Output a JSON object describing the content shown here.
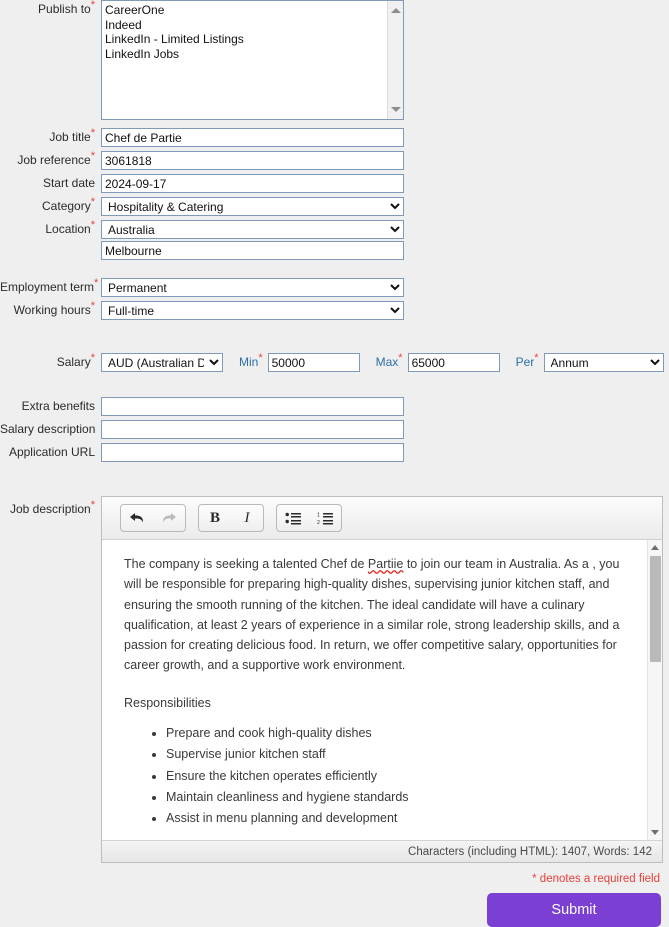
{
  "form": {
    "publish_to": {
      "label": "Publish to",
      "required": true,
      "options": [
        "CareerOne",
        "Indeed",
        "LinkedIn - Limited Listings",
        "LinkedIn Jobs"
      ]
    },
    "job_title": {
      "label": "Job title",
      "required": true,
      "value": "Chef de Partie"
    },
    "job_reference": {
      "label": "Job reference",
      "required": true,
      "value": "3061818"
    },
    "start_date": {
      "label": "Start date",
      "required": false,
      "value": "2024-09-17"
    },
    "category": {
      "label": "Category",
      "required": true,
      "value": "Hospitality & Catering"
    },
    "location": {
      "label": "Location",
      "required": true,
      "value": "Australia",
      "city_value": "Melbourne"
    },
    "employment_term": {
      "label": "Employment term",
      "required": true,
      "value": "Permanent"
    },
    "working_hours": {
      "label": "Working hours",
      "required": true,
      "value": "Full-time"
    },
    "salary": {
      "label": "Salary",
      "required": true,
      "currency_value": "AUD (Australian Do",
      "min_label": "Min",
      "min_value": "50000",
      "max_label": "Max",
      "max_value": "65000",
      "per_label": "Per",
      "per_value": "Annum"
    },
    "extra_benefits": {
      "label": "Extra benefits",
      "required": false,
      "value": ""
    },
    "salary_description": {
      "label": "Salary description",
      "required": false,
      "value": ""
    },
    "application_url": {
      "label": "Application URL",
      "required": false,
      "value": ""
    },
    "job_description": {
      "label": "Job description",
      "required": true,
      "toolbar": {
        "undo": "undo-icon",
        "redo": "redo-icon",
        "bold": "B",
        "italic": "I",
        "bullet_list": "bullet-list-icon",
        "numbered_list": "numbered-list-icon"
      },
      "body": {
        "intro_before": "The company is seeking a talented Chef de ",
        "intro_misspelled": "Partiie",
        "intro_after": " to join our team in Australia. As a , you will be responsible for preparing high-quality dishes, supervising junior kitchen staff, and ensuring the smooth running of the kitchen. The ideal candidate will have a culinary qualification, at least 2 years of experience in a similar role, strong leadership skills, and a passion for creating delicious food. In return, we offer competitive salary, opportunities for career growth, and a supportive work environment.",
        "heading": "Responsibilities",
        "bullets": [
          "Prepare and cook high-quality dishes",
          "Supervise junior kitchen staff",
          "Ensure the kitchen operates efficiently",
          "Maintain cleanliness and hygiene standards",
          "Assist in menu planning and development"
        ]
      },
      "status": "Characters (including HTML): 1407, Words: 142"
    }
  },
  "footer": {
    "denotes_note": "* denotes a required field",
    "submit_label": "Submit"
  },
  "colors": {
    "accent_purple": "#7b3fd4",
    "required_red": "#e8403a",
    "inline_label_blue": "#2f6fa8",
    "input_border": "#7e9ab8",
    "page_bg": "#efefef"
  }
}
